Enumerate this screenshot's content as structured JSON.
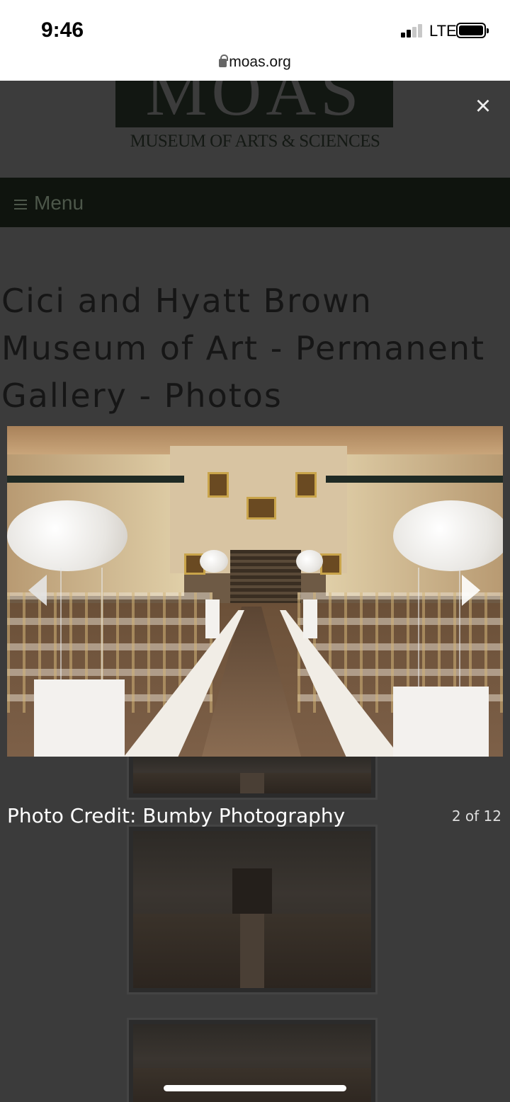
{
  "status_bar": {
    "time": "9:46",
    "network": "LTE"
  },
  "browser": {
    "url": "moas.org"
  },
  "site": {
    "logo_text": "MOAS",
    "logo_subtitle": "MUSEUM OF ARTS & SCIENCES",
    "menu_label": "Menu",
    "page_title": "Cici and Hyatt Brown Museum of Art - Permanent Gallery - Photos"
  },
  "lightbox": {
    "close_label": "×",
    "caption": "Photo Credit: Bumby Photography",
    "counter": "2 of 12",
    "image_alt": "gallery-ceremony-photo"
  }
}
